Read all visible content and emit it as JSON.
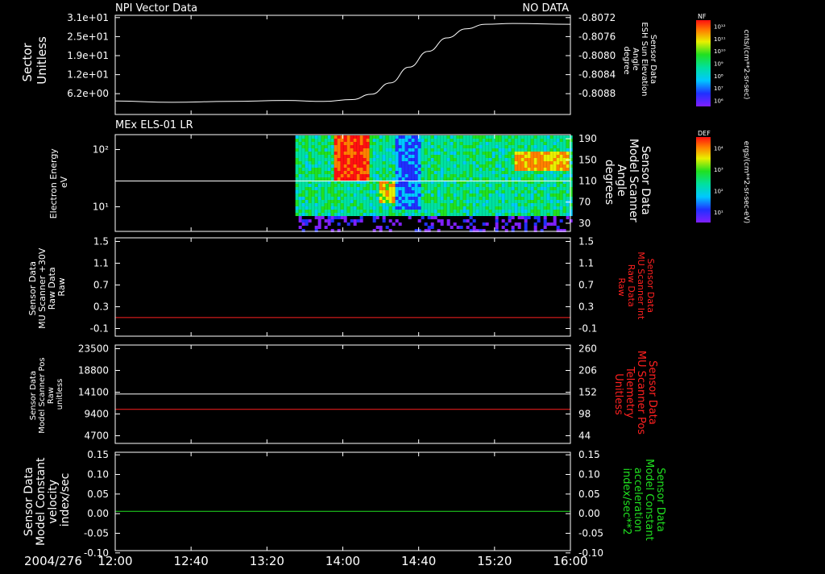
{
  "date": "2004/276",
  "x_ticks": [
    "12:00",
    "12:40",
    "13:20",
    "14:00",
    "14:40",
    "15:20",
    "16:00"
  ],
  "colors": {
    "background": "#000000",
    "foreground": "#ffffff",
    "red_trace": "#ff2020",
    "green_trace": "#20e020"
  },
  "chart_data": [
    {
      "type": "line",
      "title": "NPI Vector Data",
      "status": "NO DATA",
      "ylabel": [
        "Sector",
        "Unitless"
      ],
      "yticks": [
        "3.1e+01",
        "2.5e+01",
        "1.9e+01",
        "1.2e+01",
        "6.2e+00"
      ],
      "ylim": [
        0,
        31
      ],
      "y2label": [
        "Sensor Data",
        "ESH Sun Elevation",
        "Angle",
        "degree"
      ],
      "y2ticks": [
        "-0.8072",
        "-0.8076",
        "-0.8080",
        "-0.8084",
        "-0.8088"
      ],
      "y2lim": [
        -0.8092,
        -0.807
      ],
      "colorbar": {
        "label": "NF",
        "unit": "cnts/(cm**2-sr-sec)",
        "ticks": [
          "10¹²",
          "10¹¹",
          "10¹⁰",
          "10⁹",
          "10⁸",
          "10⁷",
          "10⁶"
        ]
      },
      "series": [
        {
          "axis": "right",
          "x": [
            "12:00",
            "12:30",
            "13:00",
            "13:30",
            "13:50",
            "14:05",
            "14:15",
            "14:25",
            "14:35",
            "14:45",
            "14:55",
            "15:05",
            "15:15",
            "15:30",
            "16:00"
          ],
          "y": [
            -0.8089,
            -0.80893,
            -0.80891,
            -0.80889,
            -0.80891,
            -0.80887,
            -0.80875,
            -0.8085,
            -0.80815,
            -0.8078,
            -0.8075,
            -0.8073,
            -0.8072,
            -0.80718,
            -0.8072
          ]
        }
      ]
    },
    {
      "type": "heatmap",
      "title": "MEx ELS-01 LR",
      "ylabel": [
        "Electron Energy",
        "eV"
      ],
      "yticks": [
        "10²",
        "10¹"
      ],
      "y2label": [
        "Sensor Data",
        "Model Scanner",
        "Angle",
        "degrees"
      ],
      "y2ticks": [
        "190",
        "150",
        "110",
        "70",
        "30"
      ],
      "y2lim": [
        0,
        190
      ],
      "data_start": "13:35",
      "white_line": {
        "axis": "right",
        "value": 99
      },
      "colorbar": {
        "label": "DEF",
        "unit": "ergs/(cm**2-sr-sec-eV)",
        "ticks": [
          "10⁴",
          "10³",
          "10²",
          "10¹"
        ]
      },
      "features": [
        {
          "start": "13:35",
          "end": "16:00",
          "low": 0.18,
          "high": 1.0,
          "level": 0.45
        },
        {
          "start": "13:55",
          "end": "14:13",
          "low": 0.55,
          "high": 1.0,
          "level": 0.95
        },
        {
          "start": "14:18",
          "end": "14:27",
          "low": 0.3,
          "high": 0.55,
          "level": 0.75
        },
        {
          "start": "14:27",
          "end": "14:40",
          "low": 0.25,
          "high": 1.0,
          "level": 0.2
        },
        {
          "start": "15:30",
          "end": "15:58",
          "low": 0.65,
          "high": 0.85,
          "level": 0.8
        }
      ]
    },
    {
      "type": "line",
      "ylabel": [
        "Sensor Data",
        "MU Scanner +30V",
        "Raw Data",
        "Raw"
      ],
      "yticks": [
        "1.5",
        "1.1",
        "0.7",
        "0.3",
        "-0.1"
      ],
      "ylim": [
        -0.35,
        1.5
      ],
      "y2label": [
        "Sensor Data",
        "MU Scanner Int",
        "Raw Data",
        "Raw"
      ],
      "y2ticks": [
        "1.5",
        "1.1",
        "0.7",
        "0.3",
        "-0.1"
      ],
      "y2lim": [
        -0.35,
        1.5
      ],
      "series": [
        {
          "axis": "right",
          "color": "red",
          "x": [
            "12:00",
            "16:00"
          ],
          "y": [
            0.0,
            0.0
          ]
        }
      ]
    },
    {
      "type": "line",
      "ylabel": [
        "Sensor Data",
        "Model Scanner Pos",
        "Raw",
        "unitless"
      ],
      "yticks": [
        "23500",
        "18800",
        "14100",
        "9400",
        "4700"
      ],
      "ylim": [
        0,
        23500
      ],
      "y2label": [
        "Sensor Data",
        "MU Scanner Pos",
        "Telemetry",
        "Unitless"
      ],
      "y2ticks": [
        "260",
        "206",
        "152",
        "98",
        "44"
      ],
      "y2lim": [
        0,
        260
      ],
      "series": [
        {
          "axis": "left",
          "color": "white",
          "x": [
            "12:00",
            "16:00"
          ],
          "y": [
            11800,
            11800
          ]
        },
        {
          "axis": "right",
          "color": "red",
          "x": [
            "12:00",
            "16:00"
          ],
          "y": [
            90,
            90
          ]
        }
      ]
    },
    {
      "type": "line",
      "ylabel": [
        "Sensor Data",
        "Model Constant",
        "velocity",
        "index/sec"
      ],
      "yticks": [
        "0.15",
        "0.10",
        "0.05",
        "0.00",
        "-0.05",
        "-0.10"
      ],
      "ylim": [
        -0.1,
        0.15
      ],
      "y2label": [
        "Sensor Data",
        "Model Constant",
        "acceleration",
        "index/sec**2"
      ],
      "y2ticks": [
        "0.15",
        "0.10",
        "0.05",
        "0.00",
        "-0.05",
        "-0.10"
      ],
      "y2lim": [
        -0.1,
        0.15
      ],
      "series": [
        {
          "axis": "right",
          "color": "green",
          "x": [
            "12:00",
            "16:00"
          ],
          "y": [
            0.0,
            0.0
          ]
        }
      ]
    }
  ]
}
